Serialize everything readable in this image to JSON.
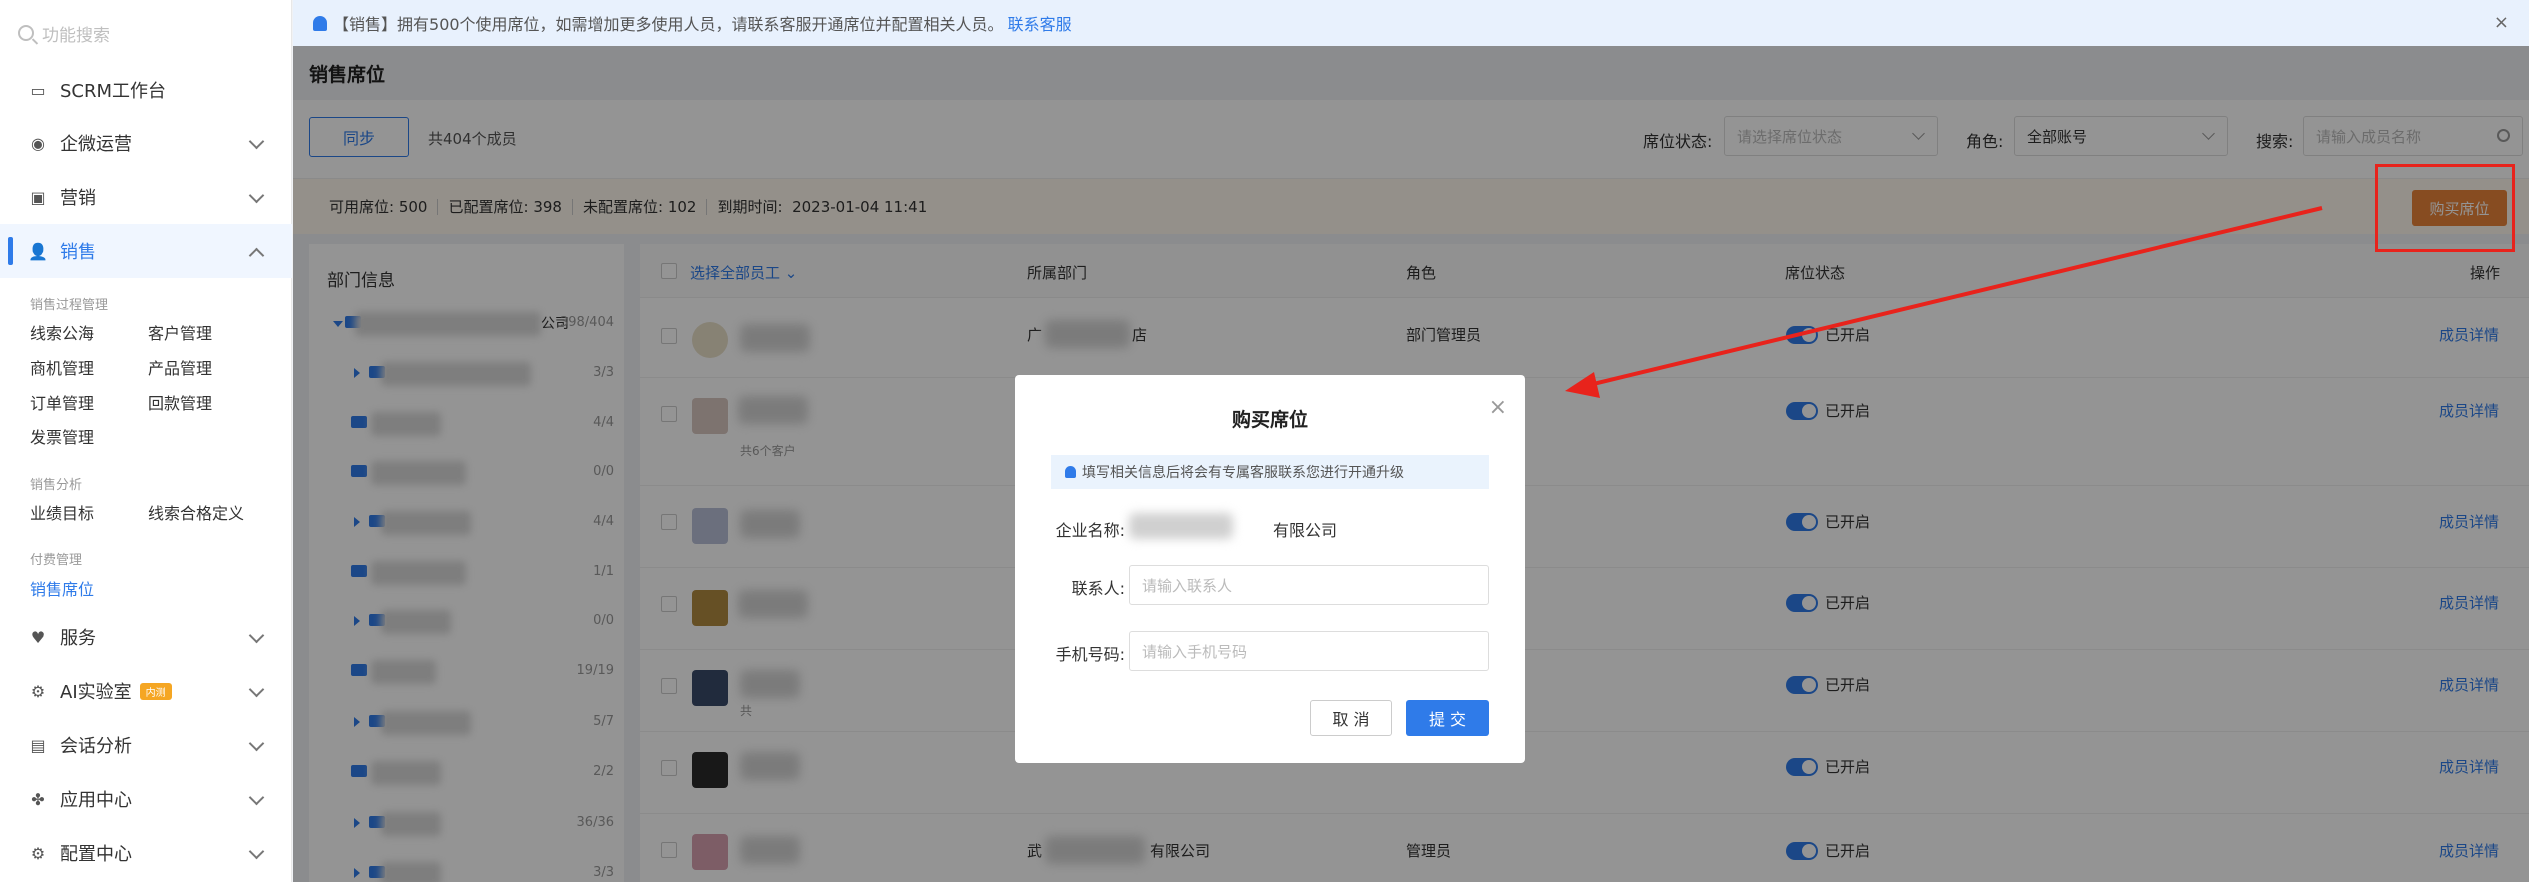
{
  "sidebar": {
    "search_placeholder": "功能搜索",
    "menu": [
      {
        "label": "SCRM工作台"
      },
      {
        "label": "企微运营"
      },
      {
        "label": "营销"
      },
      {
        "label": "销售"
      },
      {
        "label": "服务"
      },
      {
        "label": "AI实验室",
        "badge": "内测"
      },
      {
        "label": "会话分析"
      },
      {
        "label": "应用中心"
      },
      {
        "label": "配置中心"
      }
    ],
    "groups": {
      "process": "销售过程管理",
      "analysis": "销售分析",
      "paid": "付费管理"
    },
    "sublinks": {
      "leads_pool": "线索公海",
      "customer_mgmt": "客户管理",
      "opportunity_mgmt": "商机管理",
      "product_mgmt": "产品管理",
      "order_mgmt": "订单管理",
      "payment_mgmt": "回款管理",
      "invoice_mgmt": "发票管理",
      "performance_target": "业绩目标",
      "lead_qualification": "线索合格定义",
      "sales_seats": "销售席位"
    }
  },
  "notice": {
    "tag": "【销售】",
    "text": "拥有500个使用席位，如需增加更多使用人员，请联系客服开通席位并配置相关人员。",
    "link": "联系客服",
    "close": "×"
  },
  "page": {
    "title": "销售席位"
  },
  "toolbar": {
    "sync_label": "同步",
    "member_count": "共404个成员",
    "seat_status_label": "席位状态:",
    "seat_status_placeholder": "请选择席位状态",
    "role_label": "角色:",
    "role_value": "全部账号",
    "search_label": "搜索:",
    "search_placeholder": "请输入成员名称"
  },
  "stats": {
    "available_label": "可用席位:",
    "available": "500",
    "configured_label": "已配置席位:",
    "configured": "398",
    "unconfigured_label": "未配置席位:",
    "unconfigured": "102",
    "expire_label": "到期时间:",
    "expire": "2023-01-04 11:41",
    "buy_label": "购买席位"
  },
  "dept": {
    "title": "部门信息",
    "root_suffix": "公司",
    "rows": [
      {
        "count": "398/404",
        "name": ""
      },
      {
        "count": "3/3",
        "name": ""
      },
      {
        "count": "4/4",
        "name": ""
      },
      {
        "count": "0/0",
        "name": ""
      },
      {
        "count": "4/4",
        "name": ""
      },
      {
        "count": "1/1",
        "name": ""
      },
      {
        "count": "0/0",
        "name": ""
      },
      {
        "count": "19/19",
        "name": ""
      },
      {
        "count": "5/7",
        "name": ""
      },
      {
        "count": "2/2",
        "name": ""
      },
      {
        "count": "36/36",
        "name": ""
      },
      {
        "count": "3/3",
        "name": ""
      }
    ]
  },
  "table": {
    "headers": {
      "select_all": "选择全部员工",
      "department": "所属部门",
      "role": "角色",
      "seat_status": "席位状态",
      "action": "操作"
    },
    "rows": [
      {
        "dept": "广",
        "dept_suffix": "店",
        "role": "部门管理员",
        "status": "已开启",
        "action": "成员详情",
        "sub": ""
      },
      {
        "dept": "",
        "dept_suffix": "",
        "role": "",
        "status": "已开启",
        "action": "成员详情",
        "sub": "共6个客户"
      },
      {
        "dept": "",
        "dept_suffix": "",
        "role": "",
        "status": "已开启",
        "action": "成员详情",
        "sub": ""
      },
      {
        "dept": "",
        "dept_suffix": "",
        "role": "",
        "status": "已开启",
        "action": "成员详情",
        "sub": ""
      },
      {
        "dept": "",
        "dept_suffix": "",
        "role": "",
        "status": "已开启",
        "action": "成员详情",
        "sub": "共"
      },
      {
        "dept": "",
        "dept_suffix": "",
        "role": "",
        "status": "已开启",
        "action": "成员详情",
        "sub": ""
      },
      {
        "dept": "武",
        "dept_suffix": "有限公司",
        "role": "管理员",
        "status": "已开启",
        "action": "成员详情",
        "sub": ""
      }
    ]
  },
  "modal": {
    "title": "购买席位",
    "close": "×",
    "tip": "填写相关信息后将会有专属客服联系您进行开通升级",
    "company_label": "企业名称:",
    "company_suffix": "有限公司",
    "contact_label": "联系人:",
    "contact_placeholder": "请输入联系人",
    "phone_label": "手机号码:",
    "phone_placeholder": "请输入手机号码",
    "cancel": "取 消",
    "submit": "提 交"
  },
  "colors": {
    "primary": "#2f7be9",
    "buy_button": "#e8833a",
    "annotation_red": "#e8231c"
  }
}
